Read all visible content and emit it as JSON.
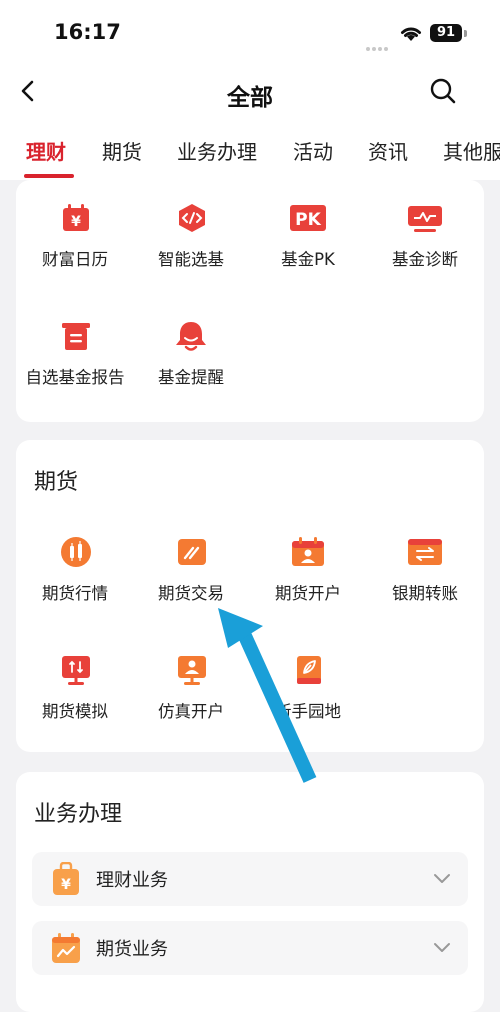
{
  "status_bar": {
    "time": "16:17",
    "battery": "91"
  },
  "nav": {
    "title": "全部"
  },
  "tabs": [
    {
      "label": "理财",
      "active": true
    },
    {
      "label": "期货"
    },
    {
      "label": "业务办理"
    },
    {
      "label": "活动"
    },
    {
      "label": "资讯"
    },
    {
      "label": "其他服务"
    }
  ],
  "wealth_section": {
    "items": [
      {
        "label": "财富日历",
        "icon": "calendar-yen-icon"
      },
      {
        "label": "智能选基",
        "icon": "code-tag-icon"
      },
      {
        "label": "基金PK",
        "icon": "pk-icon",
        "icon_text": "PK"
      },
      {
        "label": "基金诊断",
        "icon": "monitor-pulse-icon"
      },
      {
        "label": "自选基金报告",
        "icon": "report-icon"
      },
      {
        "label": "基金提醒",
        "icon": "bell-icon"
      }
    ]
  },
  "futures_section": {
    "title": "期货",
    "items": [
      {
        "label": "期货行情",
        "icon": "candlestick-icon"
      },
      {
        "label": "期货交易",
        "icon": "trade-pen-icon"
      },
      {
        "label": "期货开户",
        "icon": "account-calendar-icon"
      },
      {
        "label": "银期转账",
        "icon": "transfer-icon"
      },
      {
        "label": "期货模拟",
        "icon": "simulation-icon"
      },
      {
        "label": "仿真开户",
        "icon": "user-screen-icon"
      },
      {
        "label": "新手园地",
        "icon": "book-leaf-icon"
      }
    ]
  },
  "business_section": {
    "title": "业务办理",
    "items": [
      {
        "label": "理财业务",
        "icon": "wealth-bag-icon"
      },
      {
        "label": "期货业务",
        "icon": "futures-calendar-icon"
      }
    ]
  },
  "colors": {
    "accent": "#d9232d",
    "icon_red": "#e8413a",
    "icon_orange": "#f47a32",
    "annotation_arrow": "#1a9fd8"
  }
}
